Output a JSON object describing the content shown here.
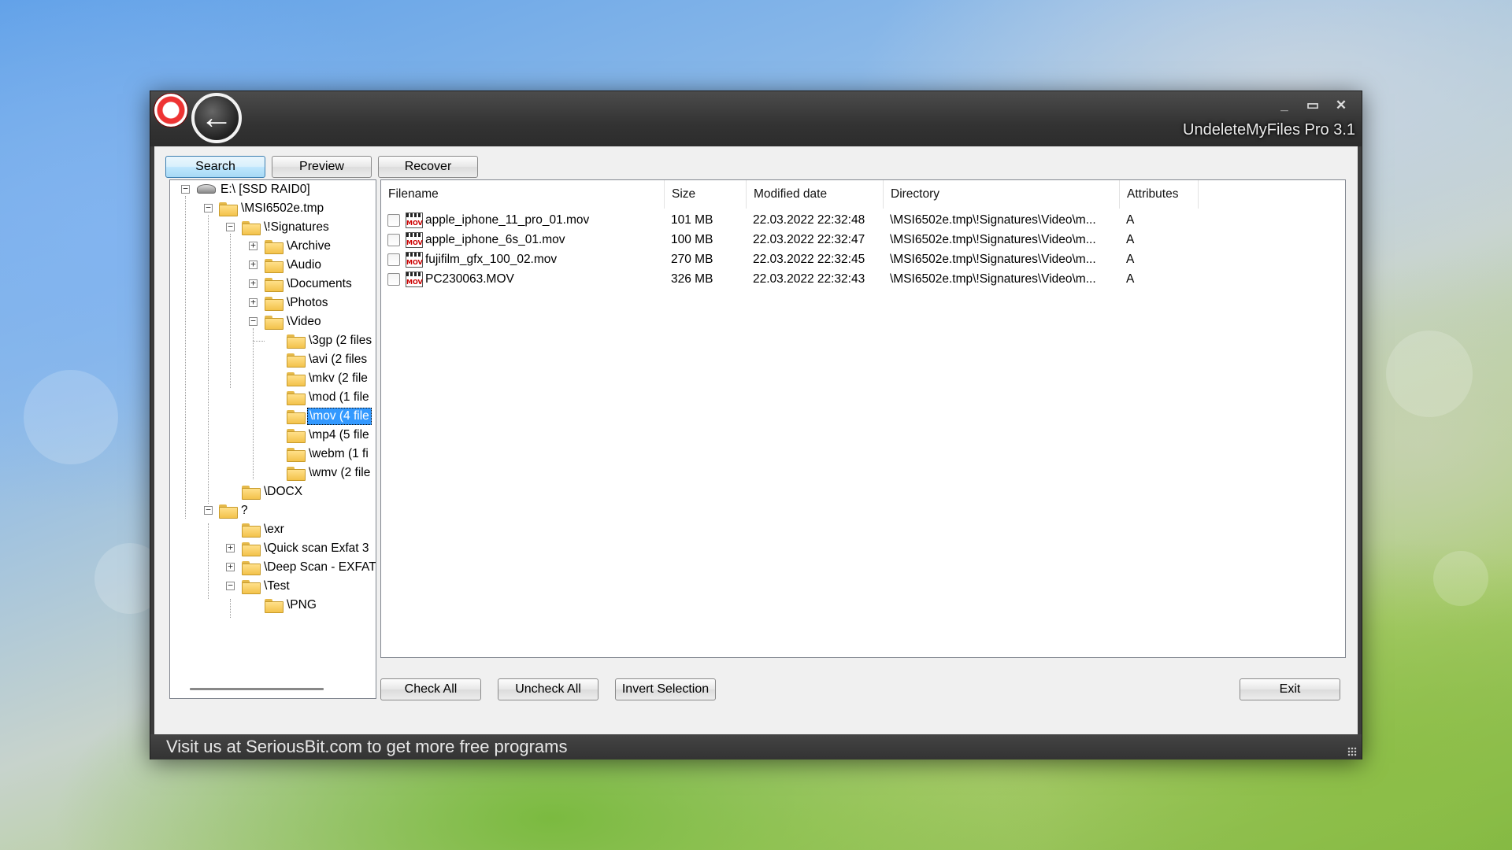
{
  "window": {
    "title": "UndeleteMyFiles Pro 3.1",
    "controls": {
      "minimize": "_",
      "maximize": "▭",
      "close": "✕"
    },
    "back_glyph": "←"
  },
  "tabs": [
    {
      "label": "Search",
      "active": true
    },
    {
      "label": "Preview",
      "active": false
    },
    {
      "label": "Recover",
      "active": false
    }
  ],
  "tree": [
    {
      "label": "E:\\     [SSD RAID0]",
      "icon": "drive",
      "expander": "−"
    },
    {
      "label": "\\MSI6502e.tmp",
      "icon": "folder",
      "expander": "−"
    },
    {
      "label": "\\!Signatures",
      "icon": "folder",
      "expander": "−"
    },
    {
      "label": "\\Archive",
      "icon": "folder",
      "expander": "+"
    },
    {
      "label": "\\Audio",
      "icon": "folder",
      "expander": "+"
    },
    {
      "label": "\\Documents",
      "icon": "folder",
      "expander": "+"
    },
    {
      "label": "\\Photos",
      "icon": "folder",
      "expander": "+"
    },
    {
      "label": "\\Video",
      "icon": "folder",
      "expander": "−"
    },
    {
      "label": "\\3gp (2 files",
      "icon": "folder",
      "expander": ""
    },
    {
      "label": "\\avi (2 files",
      "icon": "folder",
      "expander": ""
    },
    {
      "label": "\\mkv (2 file",
      "icon": "folder",
      "expander": ""
    },
    {
      "label": "\\mod (1 file",
      "icon": "folder",
      "expander": ""
    },
    {
      "label": "\\mov (4 file",
      "icon": "folder",
      "expander": "",
      "selected": true
    },
    {
      "label": "\\mp4 (5 file",
      "icon": "folder",
      "expander": ""
    },
    {
      "label": "\\webm (1 fi",
      "icon": "folder",
      "expander": ""
    },
    {
      "label": "\\wmv (2 file",
      "icon": "folder",
      "expander": ""
    },
    {
      "label": "\\DOCX",
      "icon": "folder",
      "expander": ""
    },
    {
      "label": "?",
      "icon": "folder",
      "expander": "−"
    },
    {
      "label": "\\exr",
      "icon": "folder",
      "expander": ""
    },
    {
      "label": "\\Quick scan Exfat 3",
      "icon": "folder",
      "expander": "+"
    },
    {
      "label": "\\Deep Scan - EXFAT",
      "icon": "folder",
      "expander": "+"
    },
    {
      "label": "\\Test",
      "icon": "folder",
      "expander": "−"
    },
    {
      "label": "\\PNG",
      "icon": "folder",
      "expander": ""
    }
  ],
  "list": {
    "columns": [
      "Filename",
      "Size",
      "Modified date",
      "Directory",
      "Attributes"
    ],
    "file_icon_text": "MOV",
    "rows": [
      {
        "checked": false,
        "filename": "apple_iphone_11_pro_01.mov",
        "size": "101 MB",
        "modified": "22.03.2022 22:32:48",
        "directory": "\\MSI6502e.tmp\\!Signatures\\Video\\m...",
        "attributes": "A"
      },
      {
        "checked": false,
        "filename": "apple_iphone_6s_01.mov",
        "size": "100 MB",
        "modified": "22.03.2022 22:32:47",
        "directory": "\\MSI6502e.tmp\\!Signatures\\Video\\m...",
        "attributes": "A"
      },
      {
        "checked": false,
        "filename": "fujifilm_gfx_100_02.mov",
        "size": "270 MB",
        "modified": "22.03.2022 22:32:45",
        "directory": "\\MSI6502e.tmp\\!Signatures\\Video\\m...",
        "attributes": "A"
      },
      {
        "checked": false,
        "filename": "PC230063.MOV",
        "size": "326 MB",
        "modified": "22.03.2022 22:32:43",
        "directory": "\\MSI6502e.tmp\\!Signatures\\Video\\m...",
        "attributes": "A"
      }
    ]
  },
  "actions": {
    "check_all": "Check All",
    "uncheck_all": "Uncheck All",
    "invert_selection": "Invert Selection",
    "exit": "Exit"
  },
  "status_bar": {
    "text": "Visit us at SeriousBit.com to get more free programs"
  }
}
